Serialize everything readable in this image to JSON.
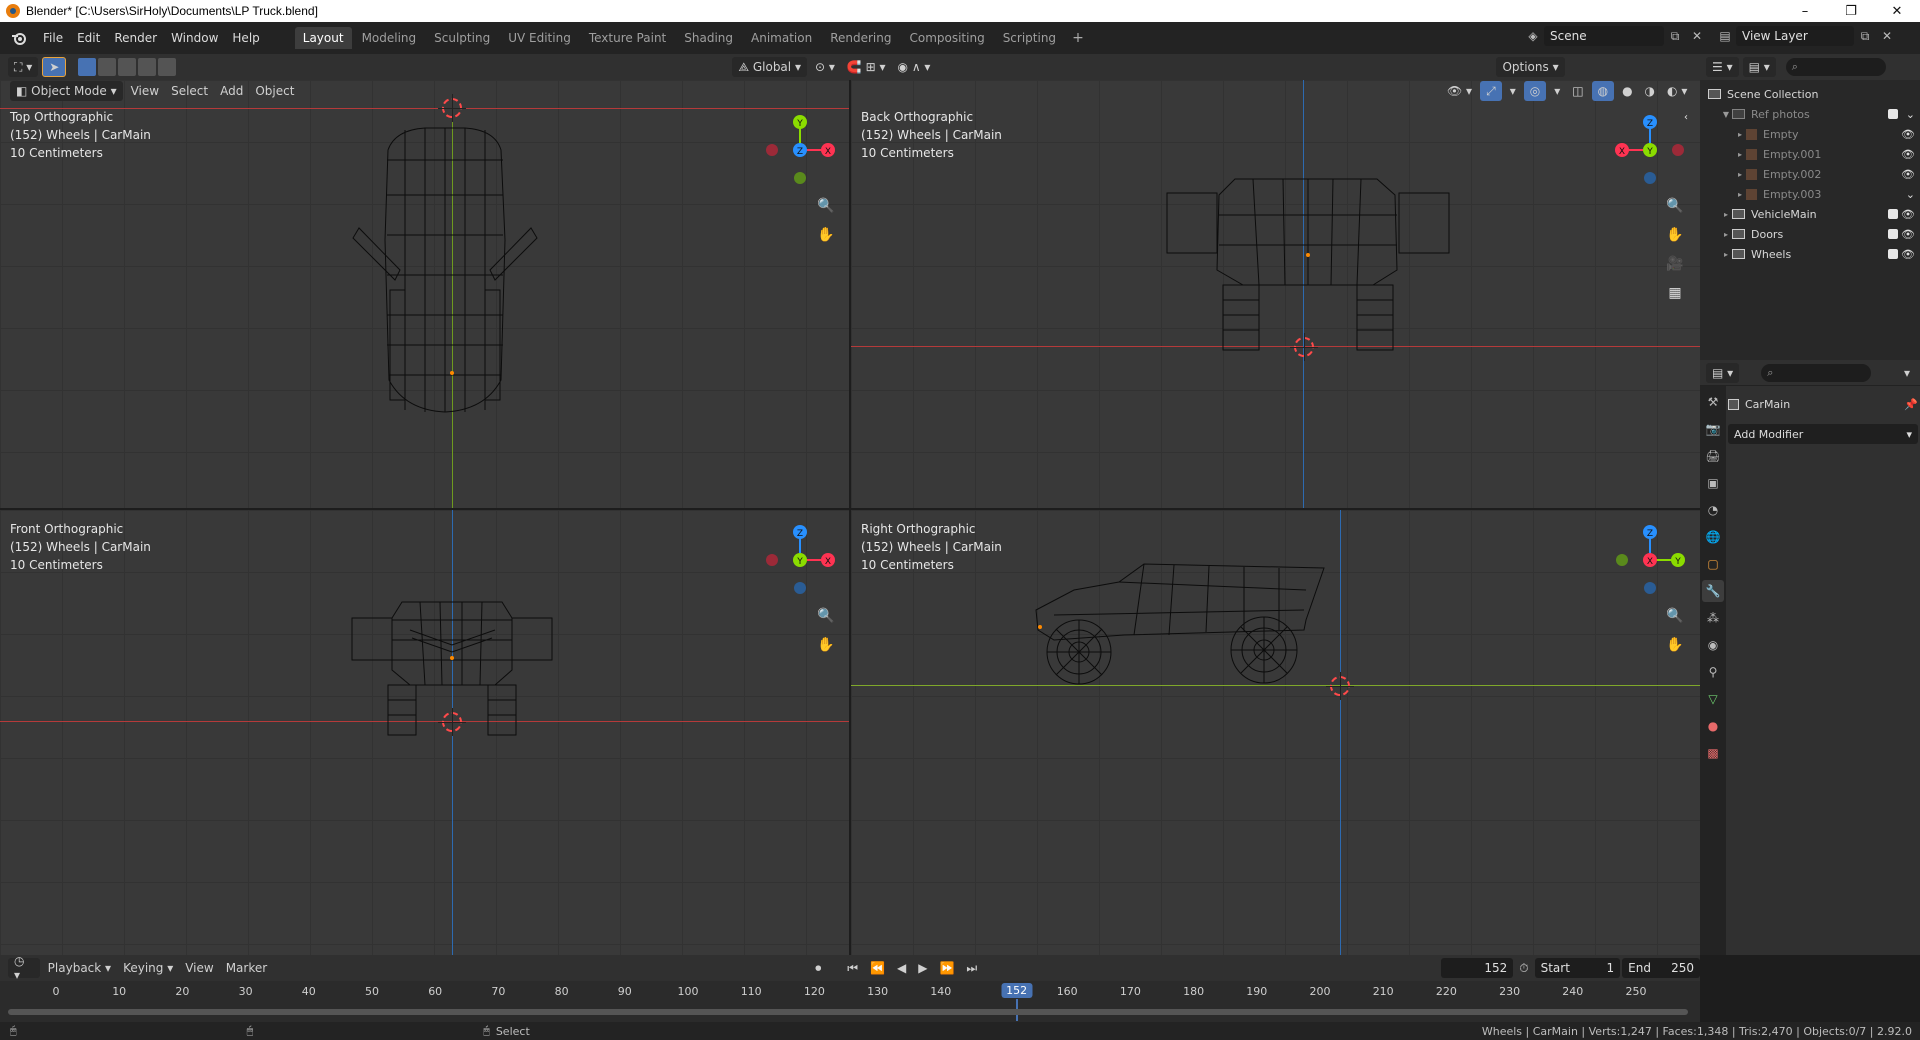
{
  "window": {
    "title": "Blender* [C:\\Users\\SirHoly\\Documents\\LP Truck.blend]",
    "controls": [
      "–",
      "❐",
      "✕"
    ]
  },
  "menus": [
    "File",
    "Edit",
    "Render",
    "Window",
    "Help"
  ],
  "workspaces": [
    "Layout",
    "Modeling",
    "Sculpting",
    "UV Editing",
    "Texture Paint",
    "Shading",
    "Animation",
    "Rendering",
    "Compositing",
    "Scripting"
  ],
  "workspace_add": "+",
  "scene": {
    "name": "Scene",
    "view_layer": "View Layer"
  },
  "viewport_header": {
    "orientation": "Global",
    "options_label": "Options"
  },
  "mode_row": {
    "mode": "Object Mode",
    "view": "View",
    "select": "Select",
    "add": "Add",
    "object": "Object"
  },
  "viewports": {
    "top": {
      "name": "Top Orthographic",
      "info": "(152) Wheels | CarMain",
      "scale": "10 Centimeters"
    },
    "back": {
      "name": "Back Orthographic",
      "info": "(152) Wheels | CarMain",
      "scale": "10 Centimeters"
    },
    "front": {
      "name": "Front Orthographic",
      "info": "(152) Wheels | CarMain",
      "scale": "10 Centimeters"
    },
    "right": {
      "name": "Right Orthographic",
      "info": "(152) Wheels | CarMain",
      "scale": "10 Centimeters"
    }
  },
  "gizmo_labels": {
    "x": "X",
    "y": "Y",
    "z": "Z"
  },
  "outliner": {
    "root": "Scene Collection",
    "items": [
      {
        "label": "Ref photos",
        "type": "collection",
        "level": 1
      },
      {
        "label": "Empty",
        "type": "empty",
        "level": 2
      },
      {
        "label": "Empty.001",
        "type": "empty",
        "level": 2
      },
      {
        "label": "Empty.002",
        "type": "empty",
        "level": 2
      },
      {
        "label": "Empty.003",
        "type": "empty",
        "level": 2
      },
      {
        "label": "VehicleMain",
        "type": "collection",
        "level": 1
      },
      {
        "label": "Doors",
        "type": "collection",
        "level": 1
      },
      {
        "label": "Wheels",
        "type": "collection",
        "level": 1
      }
    ]
  },
  "properties": {
    "object_name": "CarMain",
    "add_modifier": "Add Modifier"
  },
  "timeline": {
    "menus": [
      "Playback",
      "Keying",
      "View",
      "Marker"
    ],
    "current_frame": "152",
    "start_label": "Start",
    "start": "1",
    "end_label": "End",
    "end": "250",
    "ticks": [
      "0",
      "10",
      "20",
      "30",
      "40",
      "50",
      "60",
      "70",
      "80",
      "90",
      "100",
      "110",
      "120",
      "130",
      "140",
      "150",
      "160",
      "170",
      "180",
      "190",
      "200",
      "210",
      "220",
      "230",
      "240",
      "250"
    ]
  },
  "status": {
    "action": "Select",
    "stats": "Wheels | CarMain | Verts:1,247 | Faces:1,348 | Tris:2,470 | Objects:0/7 | 2.92.0"
  },
  "colors": {
    "axis_x": "#ff3352",
    "axis_y": "#8bdc00",
    "axis_z": "#2890ff",
    "accent": "#4772b3"
  }
}
